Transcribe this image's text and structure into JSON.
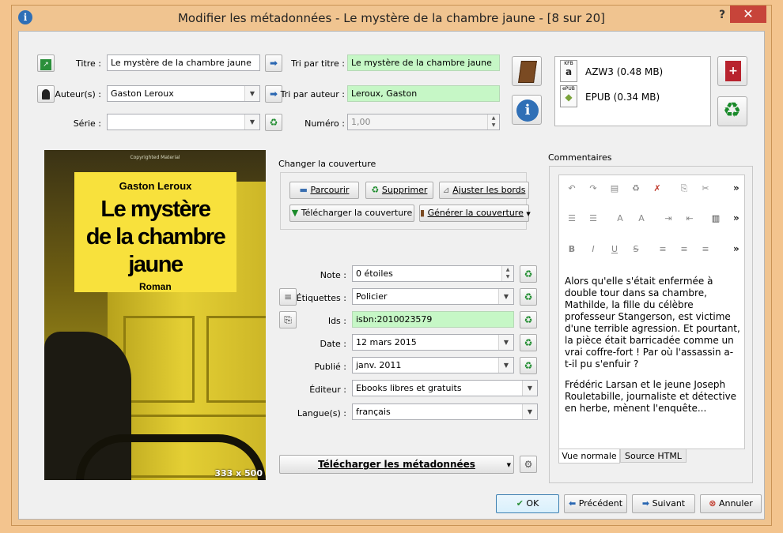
{
  "window": {
    "title": "Modifier les métadonnées - Le mystère de la chambre jaune -  [8 sur 20]",
    "help_label": "?",
    "close_label": "✕"
  },
  "fields": {
    "title_label": "Titre :",
    "title_value": "Le mystère de la chambre jaune",
    "authors_label": "Auteur(s) :",
    "authors_value": "Gaston Leroux",
    "series_label": "Série :",
    "series_value": "",
    "title_sort_label": "Tri par titre :",
    "title_sort_value": "Le mystère de la chambre jaune",
    "author_sort_label": "Tri par auteur :",
    "author_sort_value": "Leroux, Gaston",
    "number_label": "Numéro :",
    "number_value": "1,00"
  },
  "formats": [
    {
      "badge": "KFB",
      "name": "AZW3 (0.48 MB)"
    },
    {
      "badge": "ePUB",
      "name": "EPUB (0.34 MB)"
    }
  ],
  "cover": {
    "author": "Gaston Leroux",
    "title_lines": [
      "Le mystère",
      "de la chambre",
      "jaune"
    ],
    "genre": "Roman",
    "copyright": "Copyrighted Material",
    "dimensions": "333 x 500"
  },
  "change_cover": {
    "heading": "Changer la couverture",
    "browse": "Parcourir",
    "remove": "Supprimer",
    "trim": "Ajuster les bords",
    "download": "Télécharger la couverture",
    "generate": "Générer la couverture"
  },
  "metadata": {
    "rating_label": "Note :",
    "rating_value": "0 étoiles",
    "tags_label": "Étiquettes :",
    "tags_value": "Policier",
    "ids_label": "Ids :",
    "ids_value": "isbn:2010023579",
    "date_label": "Date :",
    "date_value": "12 mars 2015",
    "published_label": "Publié :",
    "published_value": "janv. 2011",
    "publisher_label": "Éditeur :",
    "publisher_value": "Ebooks libres et gratuits",
    "languages_label": "Langue(s) :",
    "languages_value": "français"
  },
  "download_metadata_label": "Télécharger les métadonnées",
  "comments": {
    "heading": "Commentaires",
    "paragraphs": [
      "Alors qu'elle s'était enfermée à double tour dans sa chambre, Mathilde, la fille du célèbre professeur Stangerson, est victime d'une terrible agression. Et pourtant, la pièce était barricadée comme un vrai coffre-fort ! Par où l'assassin a-t-il pu s'enfuir ?",
      "Frédéric Larsan et le jeune Joseph Rouletabille, journaliste et détective en herbe, mènent l'enquête..."
    ],
    "tab_normal": "Vue normale",
    "tab_html": "Source HTML",
    "more": "»"
  },
  "buttons": {
    "ok": "OK",
    "previous": "Précédent",
    "next": "Suivant",
    "cancel": "Annuler"
  }
}
